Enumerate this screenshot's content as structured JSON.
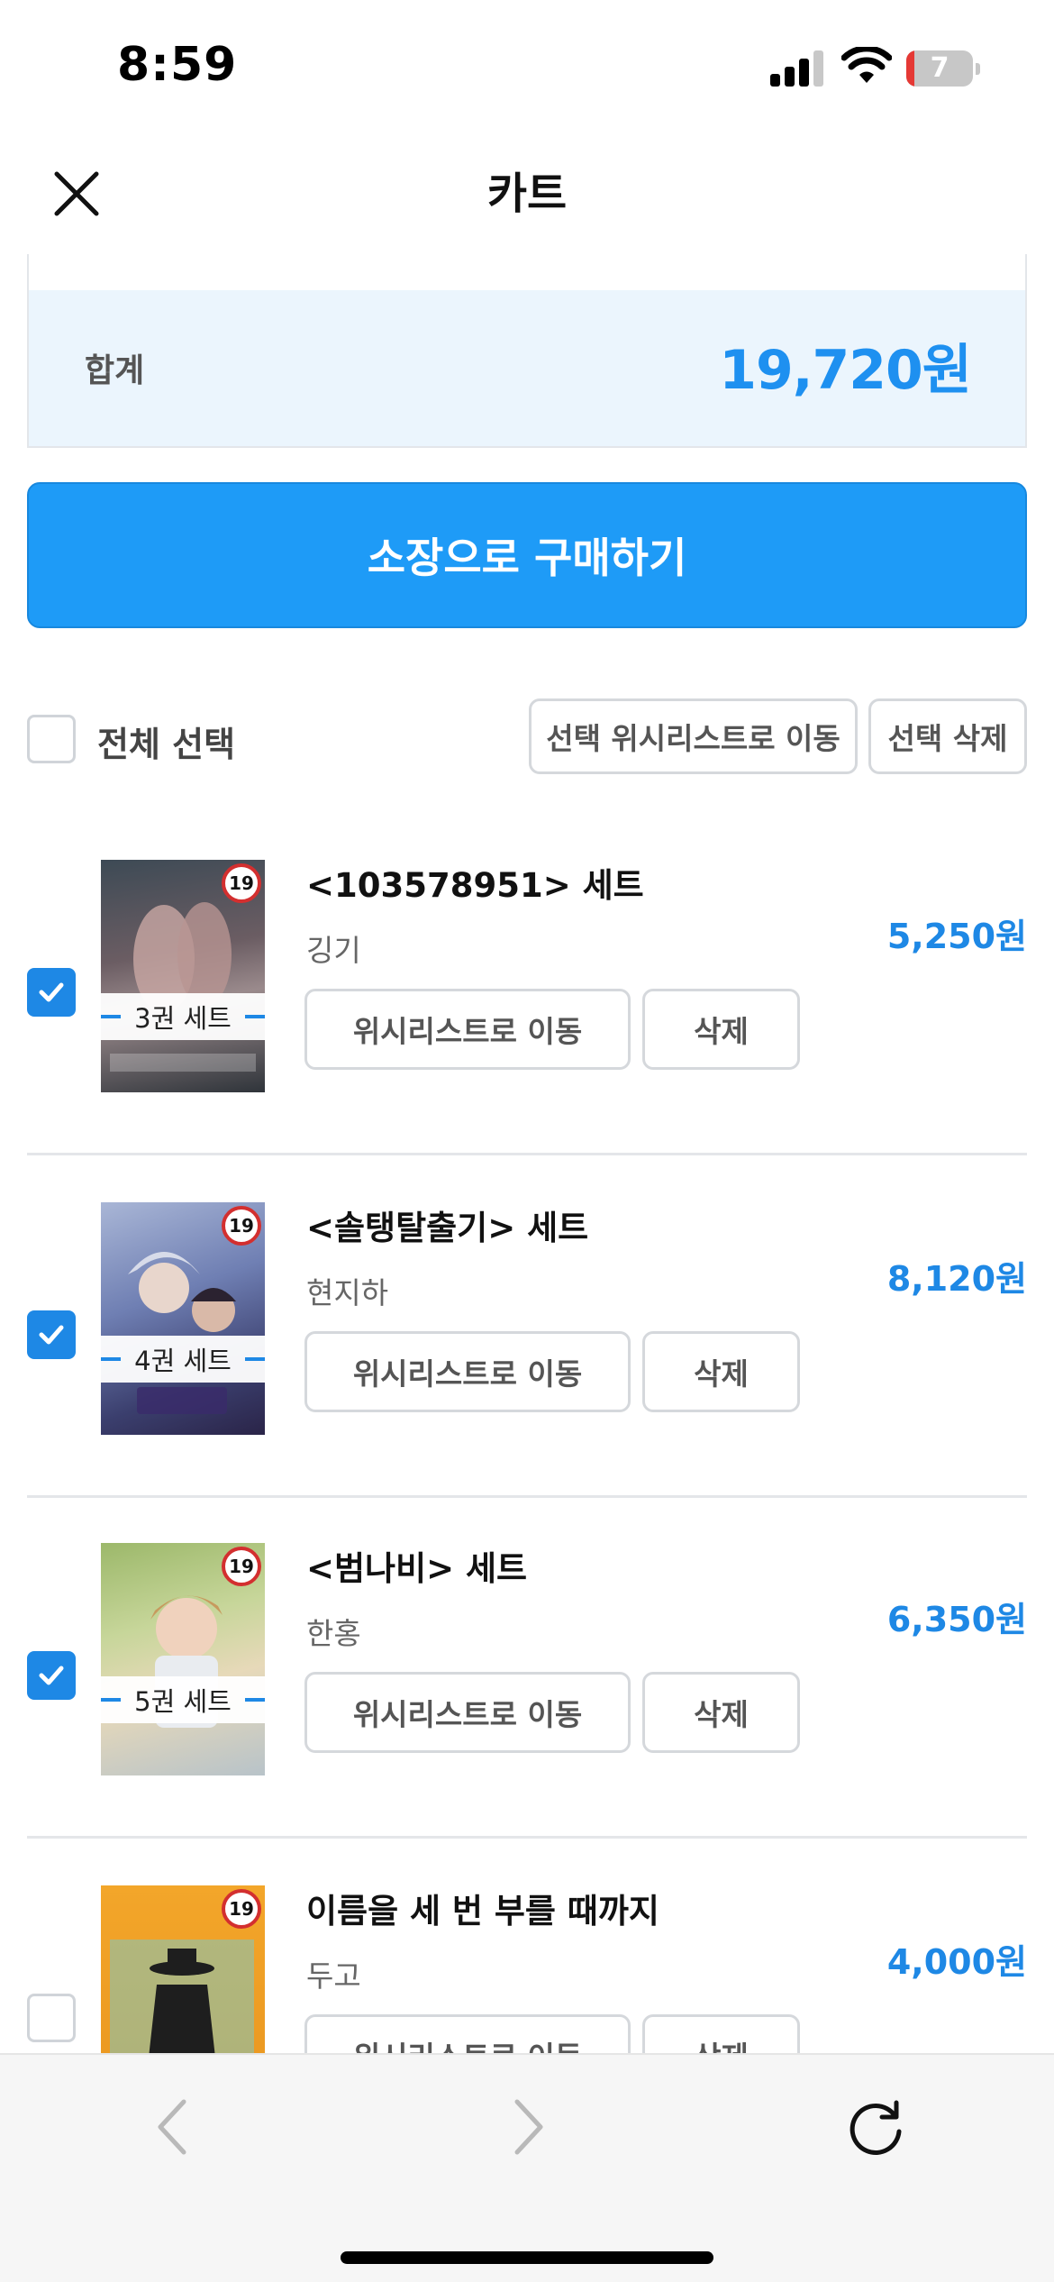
{
  "status_bar": {
    "time": "8:59",
    "battery": "7",
    "battery_level": 0.07
  },
  "header": {
    "title": "카트",
    "close_icon": "close-icon"
  },
  "summary": {
    "total_label": "합계",
    "total_value": "19,720원"
  },
  "buy_button": {
    "label": "소장으로 구매하기"
  },
  "select_all": {
    "label": "전체 선택",
    "checked": false,
    "wishlist_button": "선택 위시리스트로 이동",
    "delete_button": "선택 삭제"
  },
  "items": [
    {
      "title": "<103578951> 세트",
      "author": "깅기",
      "price": "5,250원",
      "set_label": "3권 세트",
      "age_badge": "19",
      "checked": true,
      "wishlist_button": "위시리스트로 이동",
      "delete_button": "삭제"
    },
    {
      "title": "<솔탱탈출기> 세트",
      "author": "현지하",
      "price": "8,120원",
      "set_label": "4권 세트",
      "age_badge": "19",
      "checked": true,
      "wishlist_button": "위시리스트로 이동",
      "delete_button": "삭제"
    },
    {
      "title": "<범나비> 세트",
      "author": "한홍",
      "price": "6,350원",
      "set_label": "5권 세트",
      "age_badge": "19",
      "checked": true,
      "wishlist_button": "위시리스트로 이동",
      "delete_button": "삭제"
    },
    {
      "title": "이름을 세 번 부를 때까지",
      "author": "두고",
      "price": "4,000원",
      "set_label": "",
      "age_badge": "19",
      "checked": false,
      "wishlist_button": "위시리스트로 이동",
      "delete_button": "삭제"
    }
  ],
  "toolbar": {
    "back_icon": "chevron-left-icon",
    "forward_icon": "chevron-right-icon",
    "reload_icon": "reload-icon"
  },
  "colors": {
    "accent": "#1e9bf7",
    "price": "#1e88e5",
    "summary_bg": "#ebf5fd",
    "age_badge": "#d32f2f"
  }
}
